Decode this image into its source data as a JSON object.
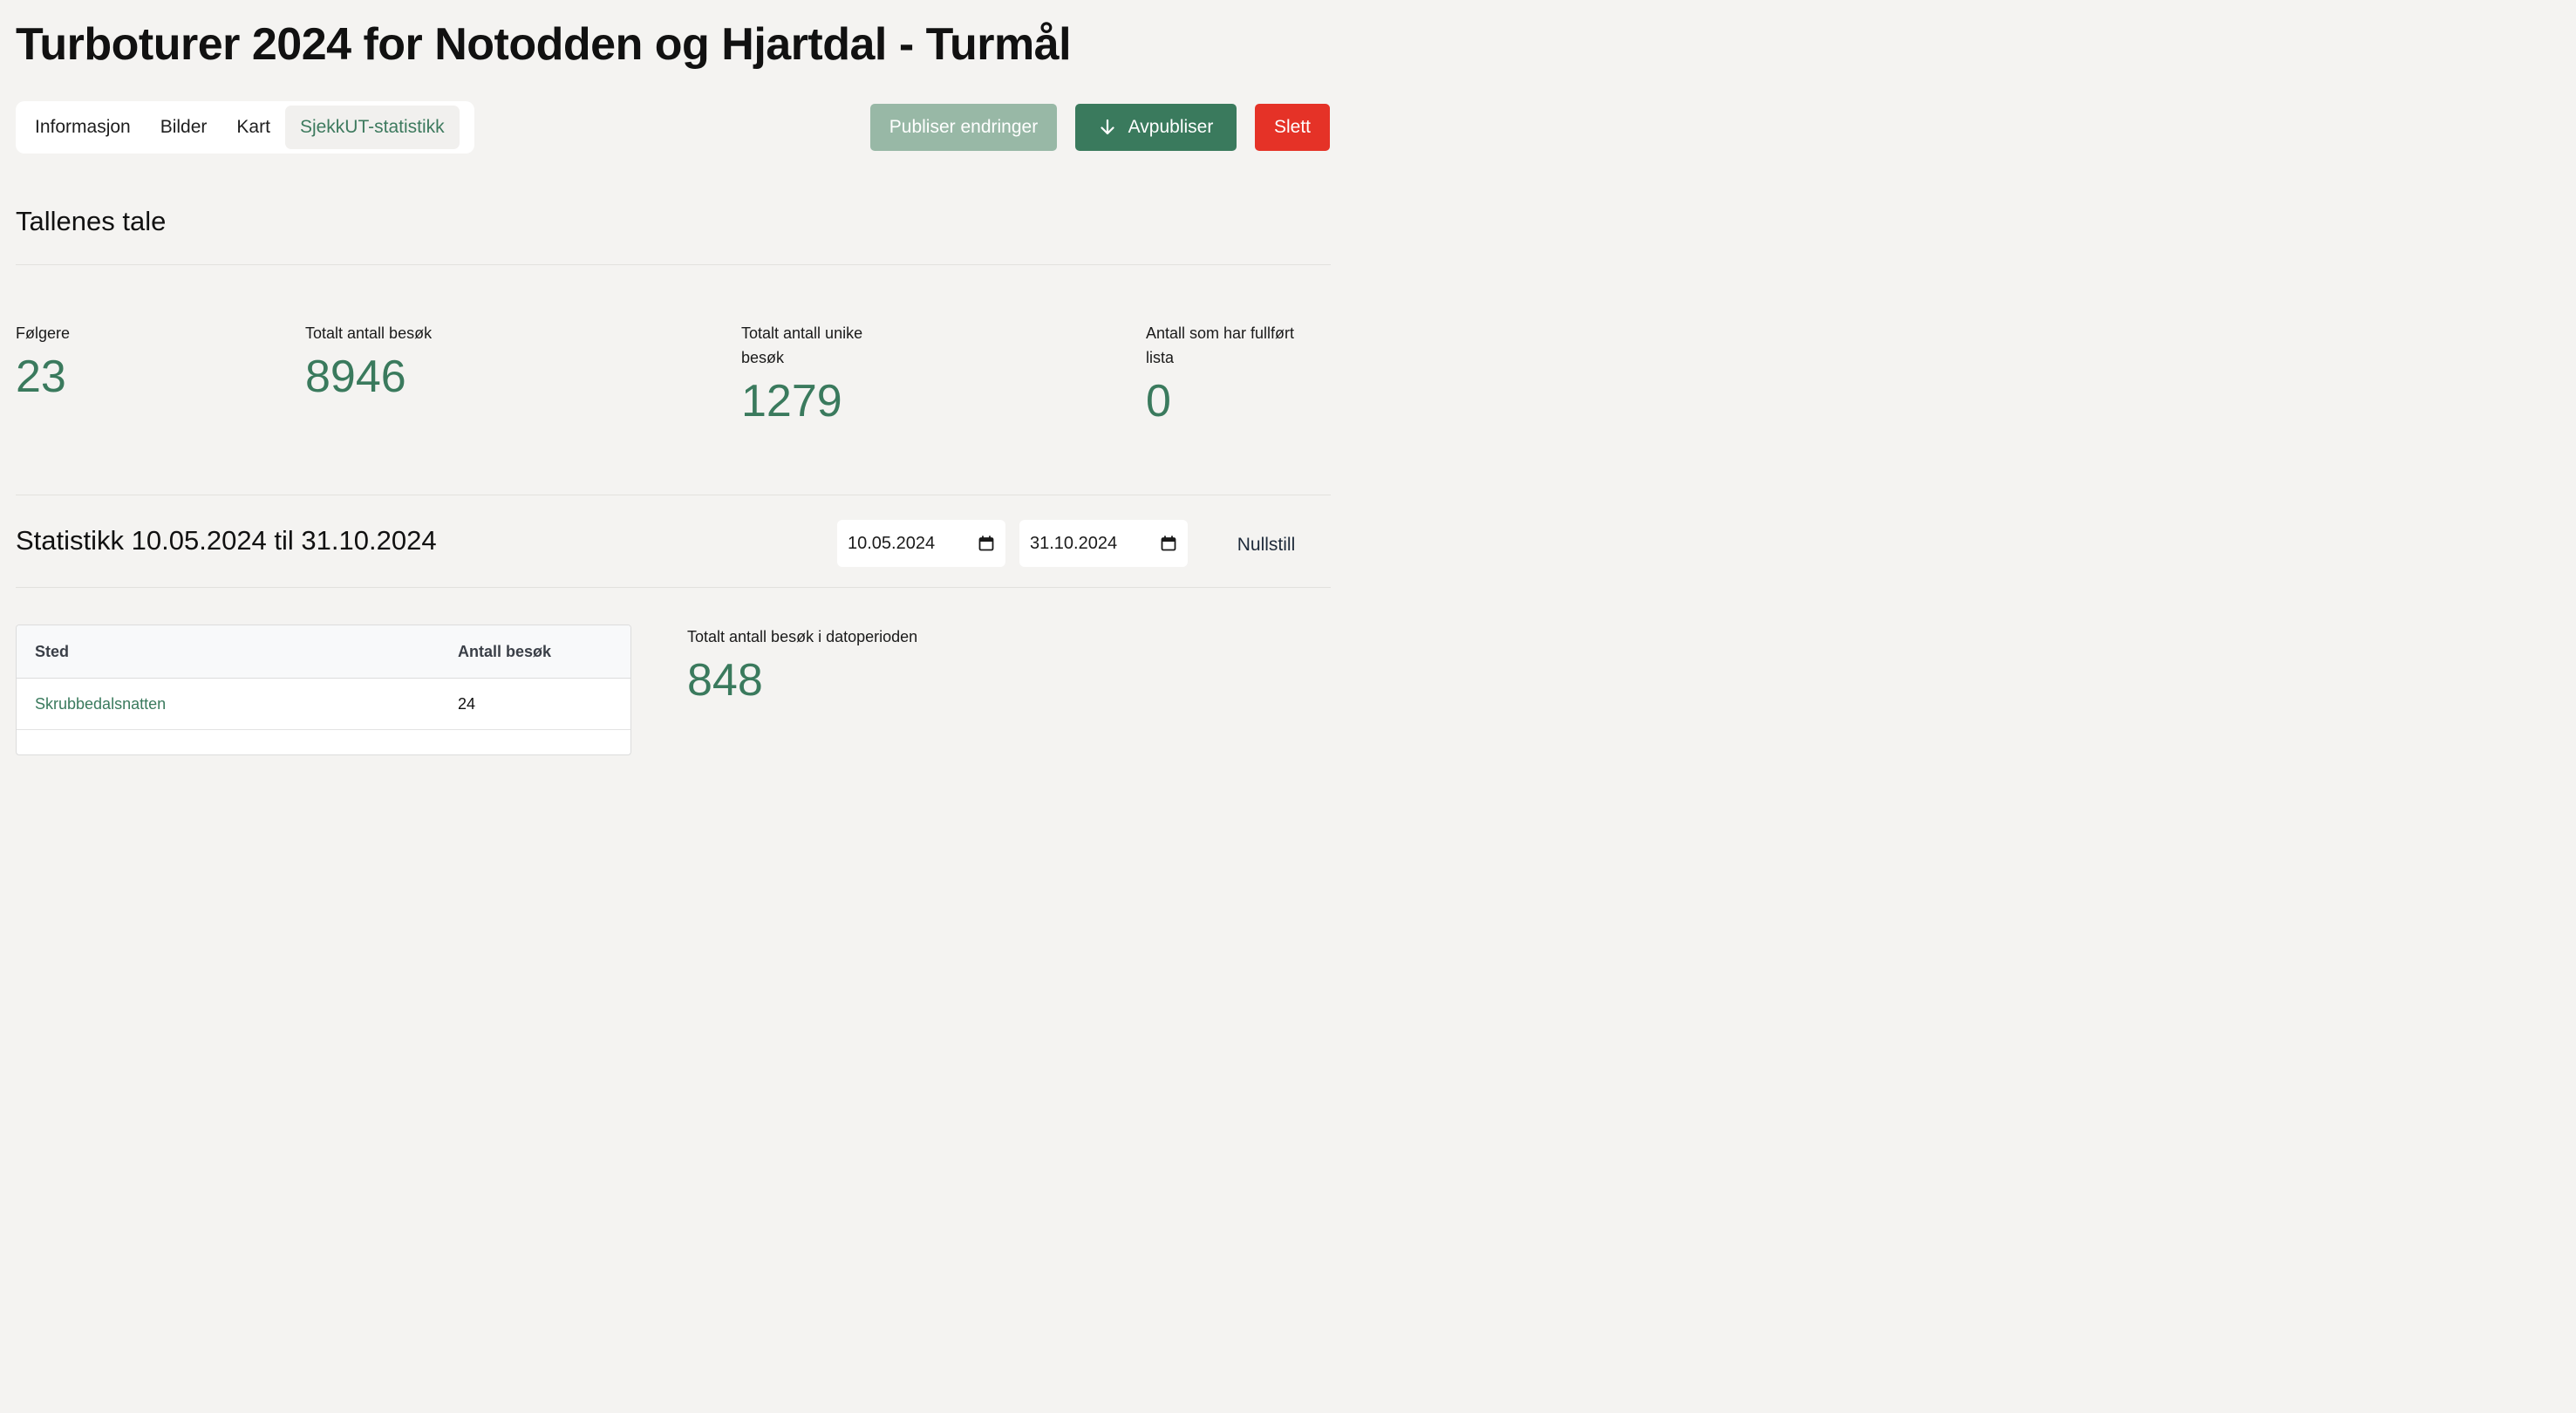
{
  "page_title": "Turboturer 2024 for Notodden og Hjartdal - Turmål",
  "tabs": [
    {
      "label": "Informasjon",
      "active": false
    },
    {
      "label": "Bilder",
      "active": false
    },
    {
      "label": "Kart",
      "active": false
    },
    {
      "label": "SjekkUT-statistikk",
      "active": true
    }
  ],
  "actions": {
    "publish_label": "Publiser endringer",
    "unpublish_label": "Avpubliser",
    "delete_label": "Slett"
  },
  "overview": {
    "heading": "Tallenes tale",
    "stats": [
      {
        "label": "Følgere",
        "value": "23"
      },
      {
        "label": "Totalt antall besøk",
        "value": "8946"
      },
      {
        "label": "Totalt antall unike besøk",
        "value": "1279"
      },
      {
        "label": "Antall som har fullført lista",
        "value": "0"
      }
    ]
  },
  "period": {
    "heading": "Statistikk 10.05.2024 til 31.10.2024",
    "from_date": "10.05.2024",
    "to_date": "31.10.2024",
    "reset_label": "Nullstill",
    "total_label": "Totalt antall besøk i datoperioden",
    "total_value": "848"
  },
  "table": {
    "columns": [
      "Sted",
      "Antall besøk"
    ],
    "rows": [
      {
        "place": "Skrubbedalsnatten",
        "visits": "24"
      }
    ]
  },
  "colors": {
    "accent": "#3a7a5d",
    "accent_disabled": "#98b8a6",
    "danger": "#e53227",
    "background": "#f4f3f1"
  },
  "icons": {
    "unpublish": "arrow-down-icon",
    "date_picker": "calendar-icon"
  }
}
